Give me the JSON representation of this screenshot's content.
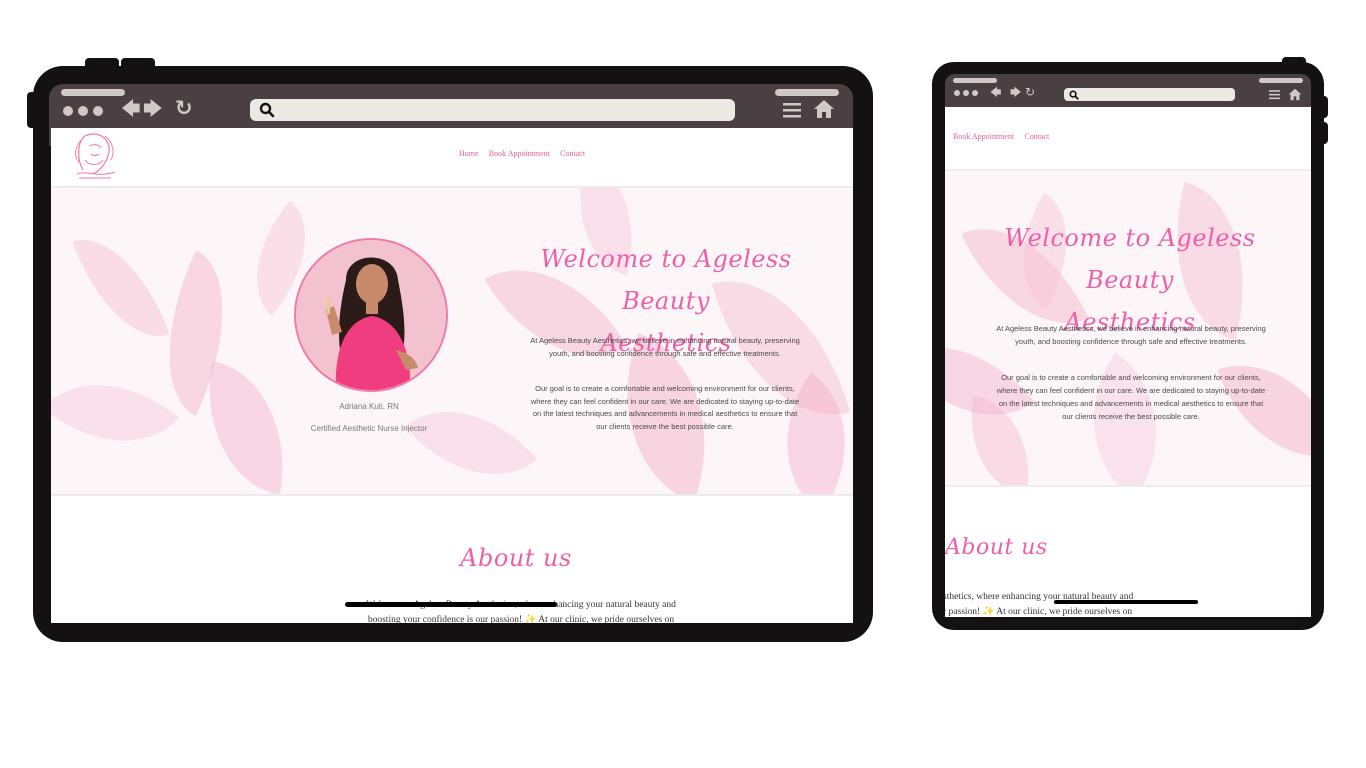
{
  "site": {
    "nav": {
      "home": "Home",
      "book": "Book Appointment",
      "contact": "Contact"
    },
    "hero": {
      "title_line1": "Welcome to Ageless Beauty",
      "title_line2": "Aesthetics",
      "paragraph1": "At Ageless Beauty Aesthetics, we believe in enhancing natural beauty, preserving youth, and boosting confidence through safe and effective treatments.",
      "paragraph2": "Our goal is to create a comfortable and welcoming environment for our clients, where they can feel confident in our care. We are dedicated to staying up-to-date on the latest techniques and advancements in medical aesthetics to ensure that our clients receive the best possible care.",
      "name": "Adriana Kuti, RN",
      "role": "Certified Aesthetic Nurse Injector"
    },
    "about": {
      "title": "About us",
      "line1": "Welcome to Ageless Beauty Aesthetics, where enhancing your natural beauty and",
      "line2": "boosting your confidence is our passion! ✨ At our clinic, we pride ourselves on",
      "mobile_line1": "sthetics, where enhancing your natural beauty and",
      "mobile_line2": "r passion! ✨ At our clinic, we pride ourselves on"
    }
  },
  "colors": {
    "accent_pink": "#ef5fa7",
    "device_frame": "#141112",
    "browser_chrome": "#4a3f42"
  },
  "icons": {
    "search": "search-icon",
    "back": "arrow-left-icon",
    "forward": "arrow-right-icon",
    "reload": "reload-icon",
    "menu": "hamburger-menu-icon",
    "home": "home-icon"
  }
}
